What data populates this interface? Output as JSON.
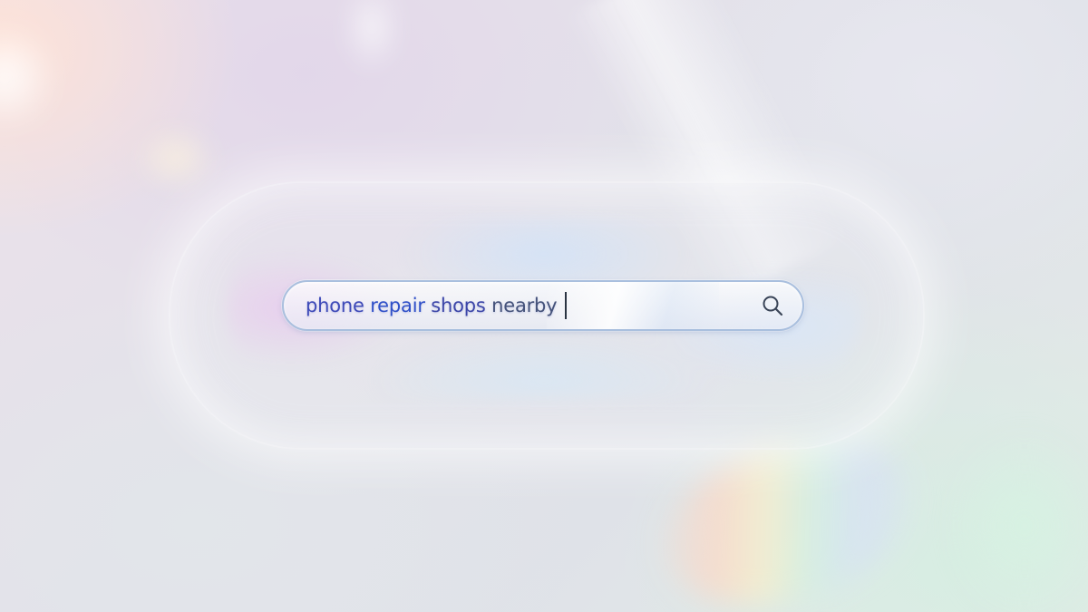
{
  "search": {
    "query_words": [
      "phone",
      "repair",
      "shops",
      "nearby"
    ],
    "search_icon": "search-icon"
  },
  "colors": {
    "search_border": "#a9bfde",
    "query_text": "#3d49b8",
    "icon_stroke": "#3a4558"
  }
}
